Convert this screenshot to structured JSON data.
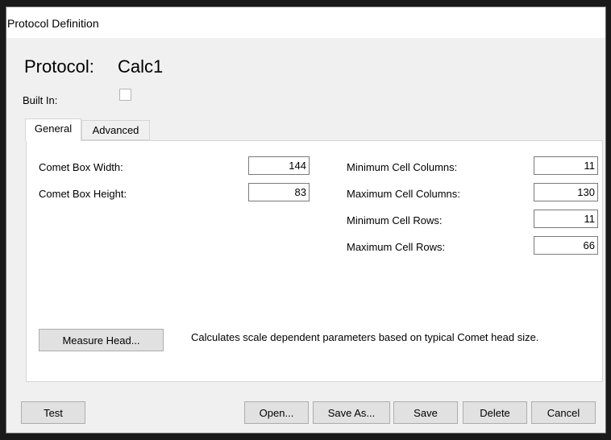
{
  "window": {
    "title": "Protocol Definition"
  },
  "protocol": {
    "label": "Protocol:",
    "name": "Calc1"
  },
  "built_in": {
    "label": "Built In:",
    "checked": false
  },
  "tabs": [
    {
      "label": "General",
      "active": true
    },
    {
      "label": "Advanced",
      "active": false
    }
  ],
  "general": {
    "comet_box_width": {
      "label": "Comet Box Width:",
      "value": "144"
    },
    "comet_box_height": {
      "label": "Comet Box Height:",
      "value": "83"
    },
    "min_cell_columns": {
      "label": "Minimum Cell Columns:",
      "value": "11"
    },
    "max_cell_columns": {
      "label": "Maximum Cell Columns:",
      "value": "130"
    },
    "min_cell_rows": {
      "label": "Minimum Cell Rows:",
      "value": "11"
    },
    "max_cell_rows": {
      "label": "Maximum Cell Rows:",
      "value": "66"
    },
    "measure_head_button": "Measure Head...",
    "measure_head_description": "Calculates scale dependent parameters based on typical Comet head size."
  },
  "buttons": {
    "test": "Test",
    "open": "Open...",
    "save_as": "Save As...",
    "save": "Save",
    "delete": "Delete",
    "cancel": "Cancel"
  }
}
